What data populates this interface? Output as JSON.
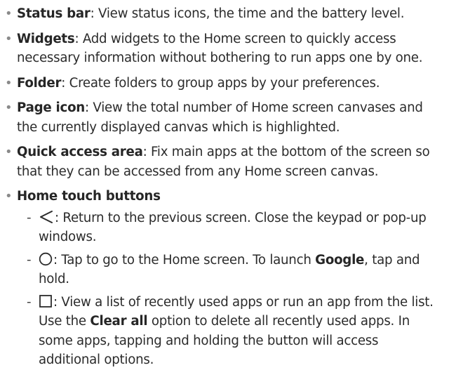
{
  "items": [
    {
      "title": "Status bar",
      "text": ": View status icons, the time and the battery level."
    },
    {
      "title": "Widgets",
      "text": ": Add widgets to the Home screen to quickly access necessary information without bothering to run apps one by one."
    },
    {
      "title": "Folder",
      "text": ": Create folders to group apps by your preferences."
    },
    {
      "title": "Page icon",
      "text": ": View the total number of Home screen canvases and the currently displayed canvas which is highlighted."
    },
    {
      "title": "Quick access area",
      "text": ": Fix main apps at the bottom of the screen so that they can be accessed from any Home screen canvas."
    },
    {
      "title": "Home touch buttons",
      "text": ""
    }
  ],
  "sub_items": [
    {
      "icon": "back-triangle-icon",
      "text": ": Return to the previous screen. Close the keypad or pop-up windows."
    },
    {
      "icon": "home-circle-icon",
      "text_a": ": Tap to go to the Home screen. To launch ",
      "bold": "Google",
      "text_b": ", tap and hold."
    },
    {
      "icon": "recent-square-icon",
      "text_a": ": View a list of recently used apps or run an app from the list. Use the ",
      "bold": "Clear all",
      "text_b": " option to delete all recently used apps. In some apps, tapping and holding the button will access additional options."
    }
  ],
  "symbols": {
    "bullet": "•",
    "dash": "-"
  },
  "colors": {
    "text": "#2b2b2b",
    "bullet": "#8a8a8a"
  }
}
